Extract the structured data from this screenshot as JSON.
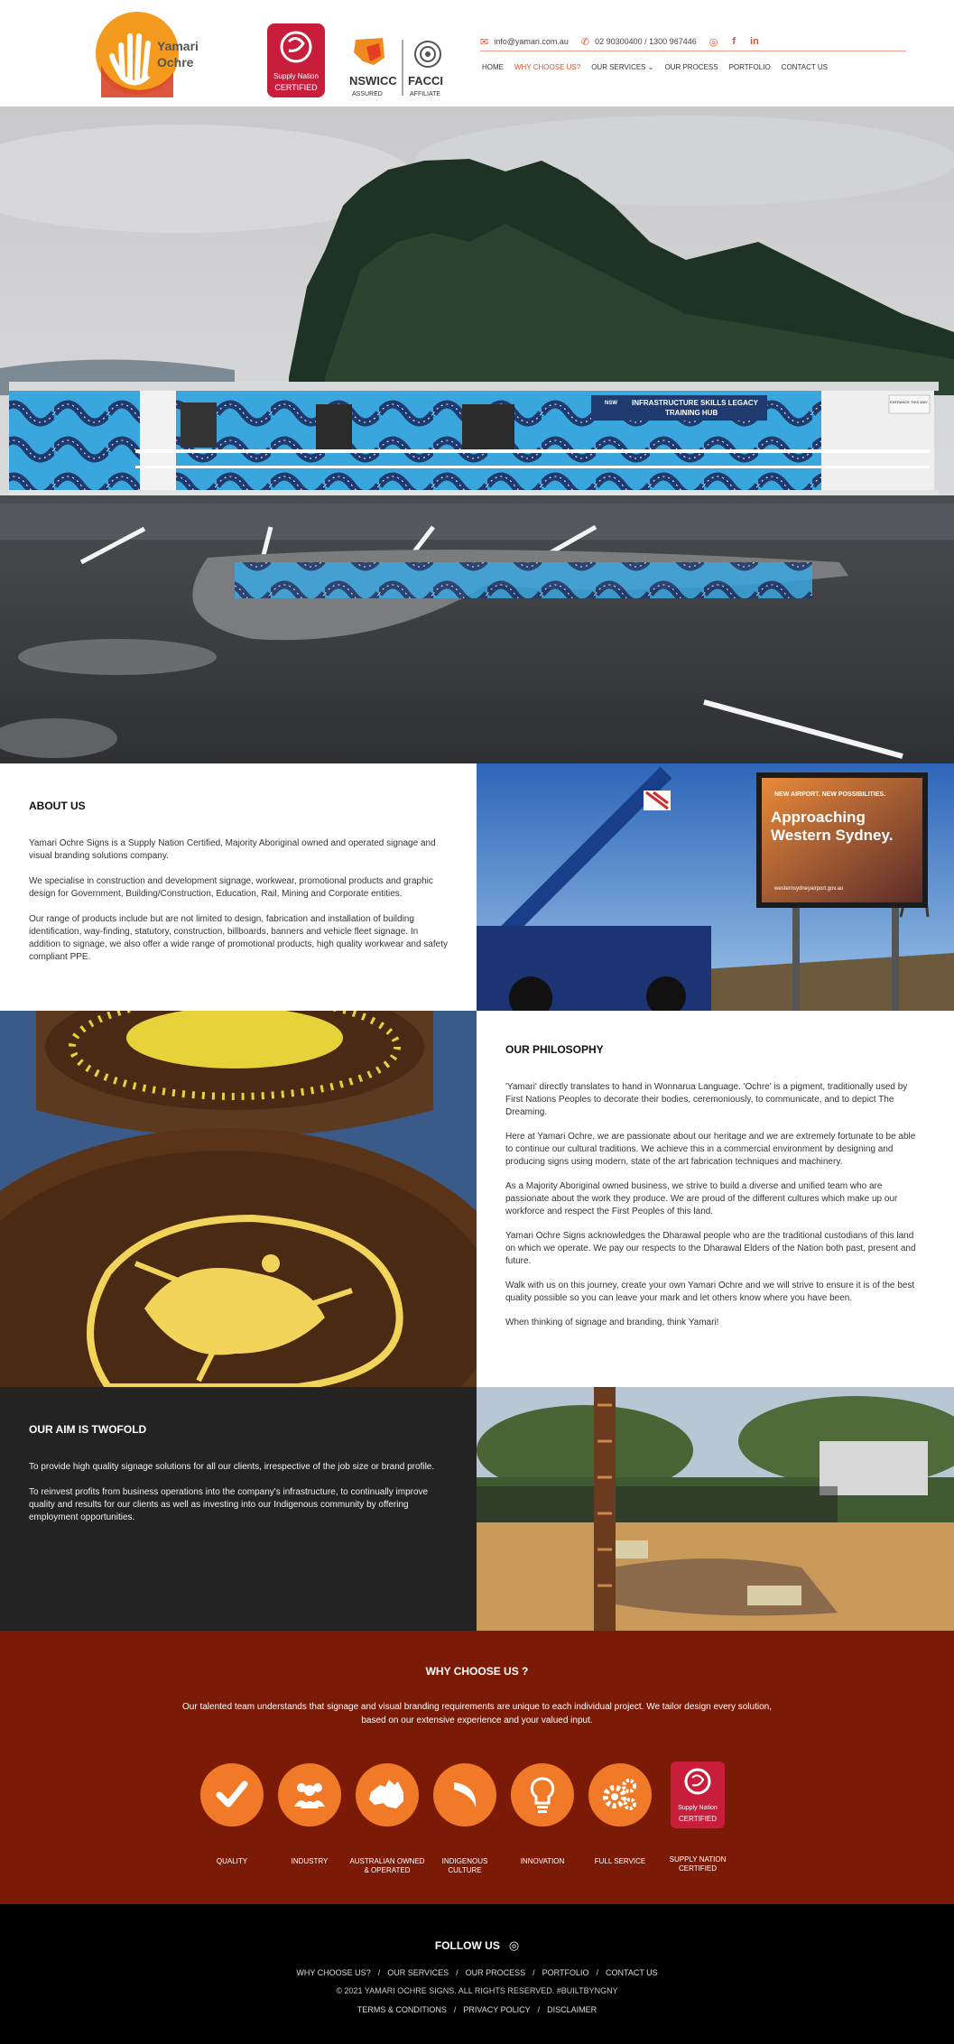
{
  "header": {
    "logo_text_1": "Yamari",
    "logo_text_2": "Ochre",
    "supply_nation_line1": "Supply Nation",
    "supply_nation_line2": "CERTIFIED",
    "nswicc_text": "NSWICC",
    "nswicc_sub": "ASSURED",
    "facci_text": "FACCI",
    "facci_sub": "AFFILIATE",
    "email": "info@yamari.com.au",
    "phone": "02 90300400 /  1300 967446"
  },
  "nav": {
    "items": [
      "HOME",
      "WHY CHOOSE US?",
      "OUR SERVICES",
      "OUR PROCESS",
      "PORTFOLIO",
      "CONTACT US"
    ]
  },
  "hero": {
    "sign_line1": "INFRASTRUCTURE SKILLS LEGACY",
    "sign_line2": "TRAINING HUB",
    "nsw_label": "NSW",
    "side_sign": "ENTRANCE THIS WAY"
  },
  "about": {
    "title": "ABOUT US",
    "p1": "Yamari Ochre Signs is a Supply Nation Certified, Majority Aboriginal owned and operated signage and visual branding solutions company.",
    "p2": "We specialise in construction and development signage, workwear, promotional products and graphic design for Government, Building/Construction, Education, Rail, Mining and Corporate entities.",
    "p3": "Our range of products include but are not limited to design, fabrication and installation of building identification, way-finding, statutory, construction, billboards, banners and vehicle fleet signage. In addition to signage, we also offer a wide range of promotional products, high quality workwear and safety compliant PPE."
  },
  "crane_image": {
    "billboard_top": "NEW AIRPORT. NEW POSSIBILITIES.",
    "billboard_main": "Approaching Western Sydney.",
    "billboard_url": "westernsydneyairport.gov.au"
  },
  "philosophy": {
    "title": "OUR PHILOSOPHY",
    "p1": "'Yamari' directly translates to hand in Wonnarua Language. 'Ochre' is a pigment, traditionally used by First Nations Peoples to decorate their bodies, ceremoniously, to communicate, and to depict The Dreaming.",
    "p2": "Here at Yamari Ochre, we are passionate about our heritage and we are extremely fortunate to be able to continue our cultural traditions. We achieve this in a commercial environment by designing and producing signs using modern, state of the art fabrication techniques and machinery.",
    "p3": "As a Majority Aboriginal owned business, we strive to build a diverse and unified team who are passionate about the work they produce. We are proud of the different cultures which make up our workforce and respect the First Peoples of this land.",
    "p4": "Yamari Ochre Signs acknowledges the Dharawal people who are the traditional custodians of this land on which we operate. We pay our respects to the Dharawal Elders of the Nation both past, present and future.",
    "p5": "Walk with us on this journey, create your own Yamari Ochre and we will strive to ensure it is of the best quality possible so you can leave your mark and let others know where you have been.",
    "p6": "When thinking of signage and branding, think Yamari!"
  },
  "aim": {
    "title": "OUR AIM IS TWOFOLD",
    "p1": "To provide high quality signage solutions for all our clients, irrespective of the job size or brand profile.",
    "p2": "To reinvest profits from business operations into the company's infrastructure, to continually improve quality and results for our clients as well as investing into our Indigenous community by offering employment opportunities."
  },
  "why": {
    "title": "WHY CHOOSE US ?",
    "text": "Our talented team understands that signage and visual branding requirements are unique to each individual project. We tailor design every solution, based on our extensive experience and your valued input.",
    "features": [
      {
        "label": "QUALITY",
        "icon": "checkmark-icon"
      },
      {
        "label": "INDUSTRY",
        "icon": "people-icon"
      },
      {
        "label": "AUSTRALIAN OWNED & OPERATED",
        "icon": "australia-map-icon"
      },
      {
        "label": "INDIGENOUS CULTURE",
        "icon": "boomerang-icon"
      },
      {
        "label": "INNOVATION",
        "icon": "lightbulb-icon"
      },
      {
        "label": "FULL SERVICE",
        "icon": "gears-icon"
      },
      {
        "label": "SUPPLY NATION CERTIFIED",
        "icon": "supply-nation-badge"
      }
    ],
    "sn_line1": "Supply Nation",
    "sn_line2": "CERTIFIED"
  },
  "footer": {
    "follow": "FOLLOW US",
    "links": [
      "WHY CHOOSE US?",
      "/",
      "OUR SERVICES",
      "/",
      "OUR PROCESS",
      "/",
      "PORTFOLIO",
      "/",
      "CONTACT US"
    ],
    "copyright": "© 2021 YAMARI OCHRE SIGNS. ALL RIGHTS RESERVED. #BUILTBYNGNY",
    "legal": [
      "TERMS & CONDITIONS",
      "/",
      "PRIVACY POLICY",
      "/",
      "DISCLAIMER"
    ]
  },
  "colors": {
    "accent": "#e0502a",
    "why_bg": "#7c1a08",
    "feature_circle": "#f07a28",
    "aim_bg": "#232323",
    "supply_nation": "#c81e3c"
  }
}
